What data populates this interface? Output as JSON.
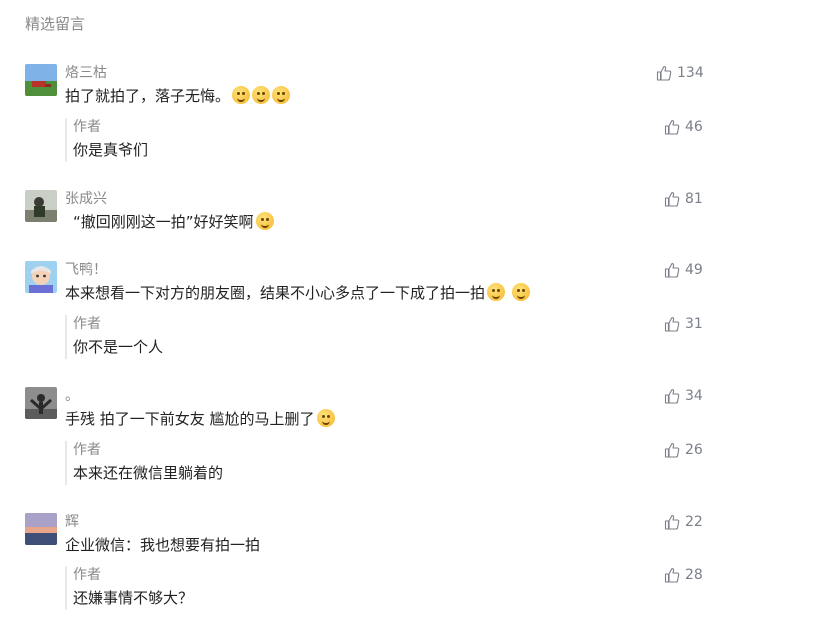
{
  "section_title": "精选留言",
  "comments": [
    {
      "nickname": "烙三枯",
      "content": "拍了就拍了，落子无悔。",
      "likes": "134",
      "emojis": [
        "thinking-emoji",
        "thinking-emoji",
        "thinking-emoji"
      ],
      "reply": {
        "author": "作者",
        "content": "你是真爷们",
        "likes": "46"
      }
    },
    {
      "nickname": "张成兴",
      "content": "“撤回刚刚这一拍”好好笑啊",
      "likes": "81",
      "emojis": [
        "rofl-emoji"
      ],
      "reply": null
    },
    {
      "nickname": "飞鸭！",
      "content": "本来想看一下对方的朋友圈，结果不小心多点了一下成了拍一拍",
      "likes": "49",
      "emojis": [
        "tears-of-joy-emoji",
        "tears-of-joy-emoji"
      ],
      "reply": {
        "author": "作者",
        "content": "你不是一个人",
        "likes": "31"
      }
    },
    {
      "nickname": "。",
      "content": "手残 拍了一下前女友  尴尬的马上删了",
      "likes": "34",
      "emojis": [
        "pleading-emoji"
      ],
      "reply": {
        "author": "作者",
        "content": "本来还在微信里躺着的",
        "likes": "26"
      }
    },
    {
      "nickname": "辉",
      "content": "企业微信：我也想要有拍一拍",
      "likes": "22",
      "emojis": [],
      "reply": {
        "author": "作者",
        "content": "还嫌事情不够大？",
        "likes": "28"
      }
    }
  ],
  "colors": {
    "meta": "#8a8a8a",
    "text": "#222222",
    "like": "#7b7f8a",
    "reply_bar": "#e8e8e8"
  }
}
